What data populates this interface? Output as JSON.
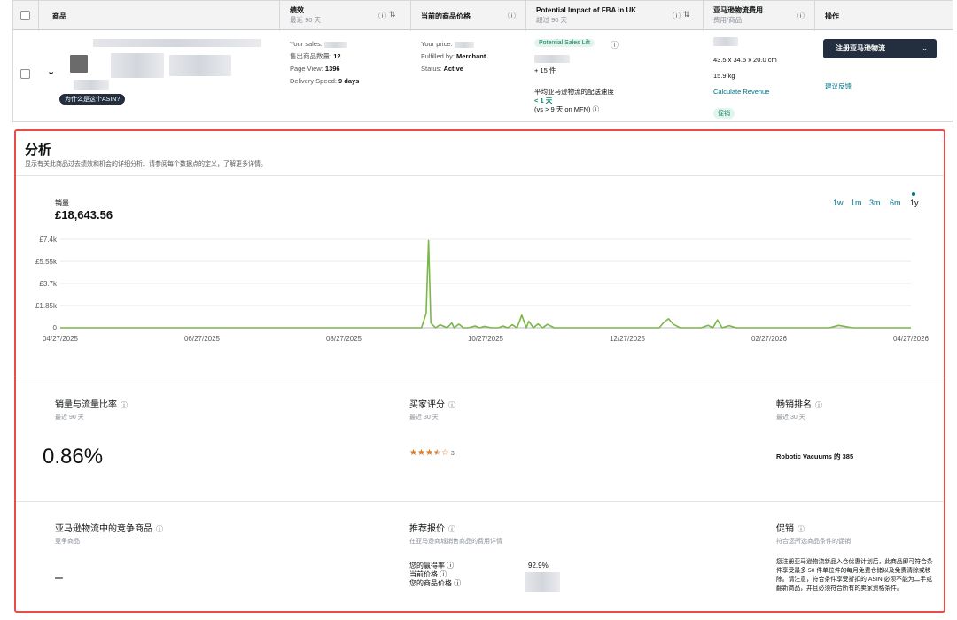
{
  "header": {
    "product": "商品",
    "performance": "绩效",
    "performance_sub": "最近 90 天",
    "price": "当前的商品价格",
    "fba_impact": "Potential Impact of FBA in UK",
    "fba_impact_sub": "超过 90 天",
    "fees": "亚马逊物流费用",
    "fees_sub": "费用/商品",
    "actions": "操作",
    "help_icon": "question-circle-icon",
    "sort_icon": "sort-icon"
  },
  "product": {
    "asin_badge": "为什么是这个ASIN?",
    "performance": {
      "sales_label": "Your sales:",
      "units_label": "售出商品数量:",
      "units_value": "12",
      "pageview_label": "Page View:",
      "pageview_value": "1396",
      "delivery_label": "Delivery Speed:",
      "delivery_value": "9 days"
    },
    "price": {
      "your_price_label": "Your price:",
      "fulfilled_label": "Fulfilled by:",
      "fulfilled_value": "Merchant",
      "status_label": "Status:",
      "status_value": "Active"
    },
    "fba": {
      "badge": "Potential Sales Lift",
      "units": "+ 15 件",
      "speed_label": "平均亚马逊物流的配送速度",
      "speed_value": "< 1 天",
      "speed_compare": "(vs > 9 天 on MFN)"
    },
    "fees": {
      "dimensions": "43.5 x 34.5 x 20.0 cm",
      "weight": "15.9 kg",
      "calc_link": "Calculate Revenue",
      "promo_badge": "促销"
    },
    "actions": {
      "register_button": "注册亚马逊物流",
      "feedback_link": "建议反馈"
    }
  },
  "analysis": {
    "title": "分析",
    "description": "显示有关此商品过去绩效和机会的详细分析。请参阅每个数据点的定义，了解更多详情。",
    "sales_label": "销量",
    "sales_value": "£18,643.56",
    "ranges": [
      "1w",
      "1m",
      "3m",
      "6m",
      "1y"
    ],
    "active_range": "1y"
  },
  "chart_data": {
    "type": "line",
    "title": "",
    "xlabel": "",
    "ylabel": "",
    "color": "#7ab648",
    "x_ticks": [
      "04/27/2025",
      "06/27/2025",
      "08/27/2025",
      "10/27/2025",
      "12/27/2025",
      "02/27/2026",
      "04/27/2026"
    ],
    "y_ticks": [
      "0",
      "£1.85k",
      "£3.7k",
      "£5.55k",
      "£7.4k"
    ],
    "y_tick_values": [
      0,
      1850,
      3700,
      5550,
      7400
    ],
    "ylim": [
      0,
      7400
    ],
    "xlim": [
      0,
      365
    ],
    "series": [
      {
        "x": [
          0,
          155,
          157,
          158,
          159,
          161,
          163,
          166,
          168,
          169,
          171,
          173,
          175,
          178,
          180,
          182,
          185,
          188,
          190,
          192,
          194,
          196,
          198,
          200,
          201,
          203,
          205,
          207,
          209,
          212,
          215,
          218,
          222,
          226,
          230,
          234,
          238,
          242,
          246,
          250,
          254,
          257,
          259,
          261,
          263,
          266,
          270,
          275,
          278,
          280,
          282,
          284,
          287,
          290,
          295,
          300,
          304,
          308,
          312,
          318,
          322,
          326,
          330,
          334,
          340,
          345,
          350,
          355,
          360,
          365
        ],
        "values": [
          0,
          0,
          1200,
          7300,
          400,
          0,
          250,
          0,
          400,
          0,
          300,
          0,
          0,
          150,
          0,
          120,
          0,
          0,
          150,
          0,
          250,
          0,
          1050,
          0,
          550,
          0,
          320,
          0,
          280,
          0,
          0,
          0,
          0,
          0,
          0,
          0,
          0,
          0,
          0,
          0,
          0,
          0,
          450,
          750,
          300,
          0,
          0,
          0,
          200,
          0,
          650,
          0,
          180,
          0,
          0,
          0,
          0,
          0,
          0,
          0,
          0,
          0,
          0,
          200,
          0,
          0,
          0,
          0,
          0,
          0
        ]
      }
    ]
  },
  "metrics": {
    "ratio_title": "销量与流量比率",
    "ratio_sub": "最近 90 天",
    "ratio_value": "0.86%",
    "rating_title": "买家评分",
    "rating_sub": "最近 30 天",
    "rating_stars": 3.5,
    "rating_count": "3",
    "rank_title": "畅销排名",
    "rank_sub": "最近 30 天",
    "rank_value": "Robotic Vacuums 的 385",
    "competition_title": "亚马逊物流中的竞争商品",
    "competition_sub": "竞争商品",
    "competition_value": "–",
    "offer_title": "推荐报价",
    "offer_sub": "在亚马逊商城销售商品的费用详情",
    "win_rate_label": "您的赢得率",
    "win_rate_value": "92.9%",
    "current_price_label": "当前价格",
    "your_price_label": "您的商品价格",
    "promo_title": "促销",
    "promo_sub": "符合您所选商品条件的促销",
    "promo_text": "您注册亚马逊物流新品入仓优惠计划后，此商品即可符合条件享受最多 50 件单位件的每月免费仓储以及免费清除或移除。请注意，符合条件享受折扣的 ASIN 必须不能为二手或翻新商品，并且必须符合所有的卖家资格条件。"
  }
}
